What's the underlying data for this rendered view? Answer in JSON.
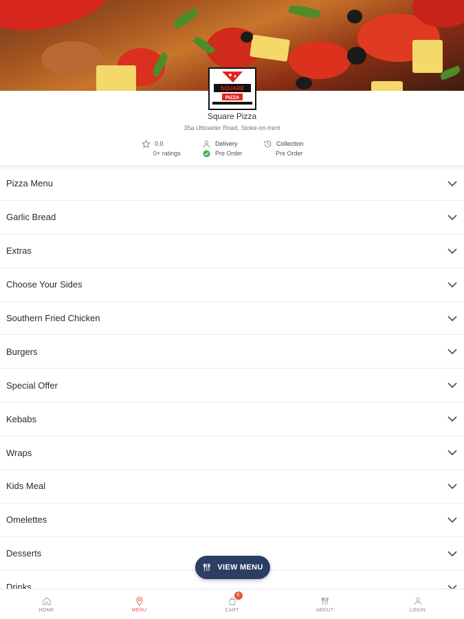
{
  "restaurant": {
    "name": "Square Pizza",
    "address": "35a Uttoxeter Road, Stoke-on-trent"
  },
  "info": {
    "rating": "0.0",
    "ratings_count": "0+ ratings",
    "delivery_label": "Delivery",
    "delivery_status": "Pre Order",
    "collection_label": "Collection",
    "collection_status": "Pre Order"
  },
  "menu": {
    "categories": [
      "Pizza Menu",
      "Garlic Bread",
      "Extras",
      "Choose Your Sides",
      "Southern Fried Chicken",
      "Burgers",
      "Special Offer",
      "Kebabs",
      "Wraps",
      "Kids Meal",
      "Omelettes",
      "Desserts",
      "Drinks"
    ]
  },
  "view_menu_label": "VIEW MENU",
  "nav": {
    "home": "HOME",
    "menu": "MENU",
    "cart": "CART",
    "cart_count": "0",
    "about": "ABOUT",
    "login": "LOGIN"
  },
  "colors": {
    "accent": "#e8553e",
    "button": "#2c3e64",
    "success": "#3bb34a"
  },
  "icons": {
    "rating": "star-icon",
    "delivery": "person-icon",
    "delivery_status": "check-circle-icon",
    "collection": "history-clock-icon",
    "category": "chevron-down-icon",
    "view_menu": "cutlery-icon",
    "home": "home-icon",
    "menu": "location-pin-icon",
    "cart": "cart-bag-icon",
    "about": "cutlery-icon",
    "login": "user-icon"
  }
}
